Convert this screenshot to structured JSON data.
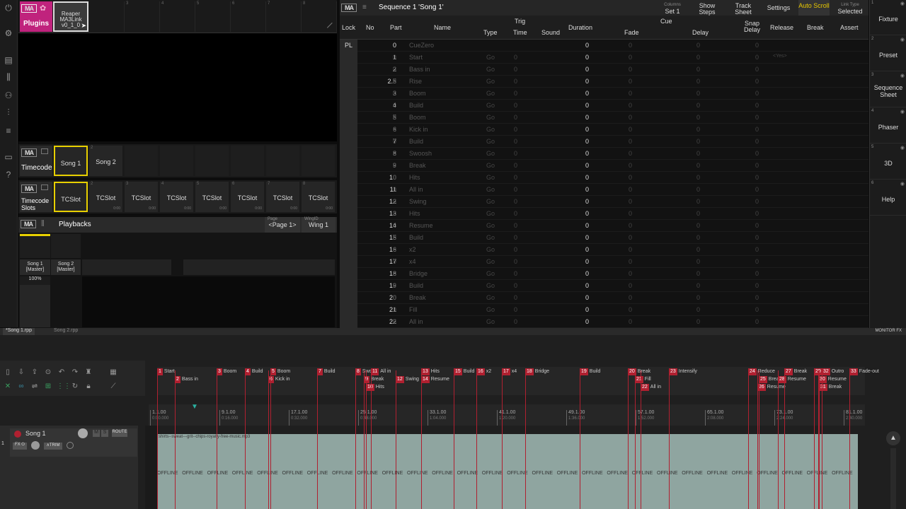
{
  "plugins_window": {
    "title": "Plugins",
    "plugin": {
      "name": "Reaper",
      "name2": "MA3Link",
      "version": "v0_1_0"
    }
  },
  "timecode_window": {
    "title": "Timecode",
    "slots": [
      "Song 1",
      "Song 2"
    ]
  },
  "timecode_slots_window": {
    "title": "Timecode Slots",
    "slots": [
      "TCSlot",
      "TCSlot",
      "TCSlot",
      "TCSlot",
      "TCSlot",
      "TCSlot",
      "TCSlot",
      "TCSlot"
    ],
    "times": [
      "0:00",
      "0:00",
      "0:00",
      "0:00",
      "0:00",
      "0:00",
      "0:00",
      "0:00"
    ]
  },
  "playbacks_window": {
    "title": "Playbacks",
    "page_label": "Page",
    "page_value": "<Page 1>",
    "wing_label": "WingID",
    "wing_value": "Wing 1",
    "executors": [
      "Song 1\n[Master]",
      "Song 2\n[Master]"
    ],
    "master_level": "100%"
  },
  "sequence_window": {
    "title": "Sequence 1 'Song 1'",
    "header_buttons": [
      {
        "small": "Columns",
        "label": "Set 1"
      },
      {
        "small": "",
        "label": "Show Steps"
      },
      {
        "small": "",
        "label": "Track Sheet"
      },
      {
        "small": "",
        "label": "Settings"
      },
      {
        "small": "",
        "label": "Auto Scroll"
      },
      {
        "small": "Link Type",
        "label": "Selected"
      }
    ],
    "columns": {
      "lock": "Lock",
      "no": "No",
      "part": "Part",
      "name": "Name",
      "trig": "Trig",
      "type": "Type",
      "time": "Time",
      "sound": "Sound",
      "duration": "Duration",
      "cue": "Cue",
      "fade": "Fade",
      "delay": "Delay",
      "snap": "Snap Delay",
      "release": "Release",
      "break": "Break",
      "assert": "Assert"
    },
    "rows": [
      {
        "lock": "PL",
        "no": "0",
        "part": "",
        "name": "CueZero",
        "type": "",
        "time": "",
        "dur": "0",
        "fade": "0",
        "delay": "0",
        "snap": "0",
        "rel": ""
      },
      {
        "lock": "",
        "no": "1",
        "part": "0",
        "name": "Start",
        "type": "Go",
        "time": "0",
        "dur": "0",
        "fade": "0",
        "delay": "0",
        "snap": "0",
        "rel": "<Yes>"
      },
      {
        "lock": "",
        "no": "2",
        "part": "0",
        "name": "Bass in",
        "type": "Go",
        "time": "0",
        "dur": "0",
        "fade": "0",
        "delay": "0",
        "snap": "0",
        "rel": ""
      },
      {
        "lock": "",
        "no": "2.5",
        "part": "0",
        "name": "Rise",
        "type": "Go",
        "time": "0",
        "dur": "0",
        "fade": "0",
        "delay": "0",
        "snap": "0",
        "rel": ""
      },
      {
        "lock": "",
        "no": "3",
        "part": "0",
        "name": "Boom",
        "type": "Go",
        "time": "0",
        "dur": "0",
        "fade": "0",
        "delay": "0",
        "snap": "0",
        "rel": ""
      },
      {
        "lock": "",
        "no": "4",
        "part": "0",
        "name": "Build",
        "type": "Go",
        "time": "0",
        "dur": "0",
        "fade": "0",
        "delay": "0",
        "snap": "0",
        "rel": ""
      },
      {
        "lock": "",
        "no": "5",
        "part": "0",
        "name": "Boom",
        "type": "Go",
        "time": "0",
        "dur": "0",
        "fade": "0",
        "delay": "0",
        "snap": "0",
        "rel": ""
      },
      {
        "lock": "",
        "no": "6",
        "part": "0",
        "name": "Kick in",
        "type": "Go",
        "time": "0",
        "dur": "0",
        "fade": "0",
        "delay": "0",
        "snap": "0",
        "rel": ""
      },
      {
        "lock": "",
        "no": "7",
        "part": "0",
        "name": "Build",
        "type": "Go",
        "time": "0",
        "dur": "0",
        "fade": "0",
        "delay": "0",
        "snap": "0",
        "rel": ""
      },
      {
        "lock": "",
        "no": "8",
        "part": "0",
        "name": "Swoosh",
        "type": "Go",
        "time": "0",
        "dur": "0",
        "fade": "0",
        "delay": "0",
        "snap": "0",
        "rel": ""
      },
      {
        "lock": "",
        "no": "9",
        "part": "0",
        "name": "Break",
        "type": "Go",
        "time": "0",
        "dur": "0",
        "fade": "0",
        "delay": "0",
        "snap": "0",
        "rel": ""
      },
      {
        "lock": "",
        "no": "10",
        "part": "0",
        "name": "Hits",
        "type": "Go",
        "time": "0",
        "dur": "0",
        "fade": "0",
        "delay": "0",
        "snap": "0",
        "rel": ""
      },
      {
        "lock": "",
        "no": "11",
        "part": "0",
        "name": "All in",
        "type": "Go",
        "time": "0",
        "dur": "0",
        "fade": "0",
        "delay": "0",
        "snap": "0",
        "rel": ""
      },
      {
        "lock": "",
        "no": "12",
        "part": "0",
        "name": "Swing",
        "type": "Go",
        "time": "0",
        "dur": "0",
        "fade": "0",
        "delay": "0",
        "snap": "0",
        "rel": ""
      },
      {
        "lock": "",
        "no": "13",
        "part": "0",
        "name": "Hits",
        "type": "Go",
        "time": "0",
        "dur": "0",
        "fade": "0",
        "delay": "0",
        "snap": "0",
        "rel": ""
      },
      {
        "lock": "",
        "no": "14",
        "part": "0",
        "name": "Resume",
        "type": "Go",
        "time": "0",
        "dur": "0",
        "fade": "0",
        "delay": "0",
        "snap": "0",
        "rel": ""
      },
      {
        "lock": "",
        "no": "15",
        "part": "0",
        "name": "Build",
        "type": "Go",
        "time": "0",
        "dur": "0",
        "fade": "0",
        "delay": "0",
        "snap": "0",
        "rel": ""
      },
      {
        "lock": "",
        "no": "16",
        "part": "0",
        "name": "x2",
        "type": "Go",
        "time": "0",
        "dur": "0",
        "fade": "0",
        "delay": "0",
        "snap": "0",
        "rel": ""
      },
      {
        "lock": "",
        "no": "17",
        "part": "0",
        "name": "x4",
        "type": "Go",
        "time": "0",
        "dur": "0",
        "fade": "0",
        "delay": "0",
        "snap": "0",
        "rel": ""
      },
      {
        "lock": "",
        "no": "18",
        "part": "0",
        "name": "Bridge",
        "type": "Go",
        "time": "0",
        "dur": "0",
        "fade": "0",
        "delay": "0",
        "snap": "0",
        "rel": ""
      },
      {
        "lock": "",
        "no": "19",
        "part": "0",
        "name": "Build",
        "type": "Go",
        "time": "0",
        "dur": "0",
        "fade": "0",
        "delay": "0",
        "snap": "0",
        "rel": ""
      },
      {
        "lock": "",
        "no": "20",
        "part": "0",
        "name": "Break",
        "type": "Go",
        "time": "0",
        "dur": "0",
        "fade": "0",
        "delay": "0",
        "snap": "0",
        "rel": ""
      },
      {
        "lock": "",
        "no": "21",
        "part": "0",
        "name": "Fill",
        "type": "Go",
        "time": "0",
        "dur": "0",
        "fade": "0",
        "delay": "0",
        "snap": "0",
        "rel": ""
      },
      {
        "lock": "",
        "no": "22",
        "part": "0",
        "name": "All in",
        "type": "Go",
        "time": "0",
        "dur": "0",
        "fade": "0",
        "delay": "0",
        "snap": "0",
        "rel": ""
      }
    ]
  },
  "right_bar": [
    {
      "n": "1",
      "label": "Fixture"
    },
    {
      "n": "2",
      "label": "Preset"
    },
    {
      "n": "3",
      "label": "Sequence Sheet"
    },
    {
      "n": "4",
      "label": "Phaser"
    },
    {
      "n": "5",
      "label": "3D"
    },
    {
      "n": "6",
      "label": "Help"
    }
  ],
  "reaper": {
    "tabs": [
      "*Song 1.rpp",
      "Song 2.rpp"
    ],
    "monitor_fx": "MONITOR FX",
    "track_name": "Song 1",
    "route_label": "ROUTE",
    "item_name": "shirts--sweat---grit--chips-royalty-free-music.mp3",
    "offline_label": "OFFLINE",
    "markers_row1": [
      {
        "n": "1",
        "label": "Start"
      },
      {
        "n": "3",
        "label": "Boom"
      },
      {
        "n": "4",
        "label": "Build"
      },
      {
        "n": "5",
        "label": "Boom"
      },
      {
        "n": "7",
        "label": "Build"
      },
      {
        "n": "8",
        "label": "Swo"
      },
      {
        "n": "11",
        "label": "All in"
      },
      {
        "n": "13",
        "label": "Hits"
      },
      {
        "n": "15",
        "label": "Build"
      },
      {
        "n": "16",
        "label": "x2"
      },
      {
        "n": "17",
        "label": "x4"
      },
      {
        "n": "18",
        "label": "Bridge"
      },
      {
        "n": "19",
        "label": "Build"
      },
      {
        "n": "20",
        "label": "Break"
      },
      {
        "n": "23",
        "label": "Intensify"
      },
      {
        "n": "24",
        "label": "Reduce"
      },
      {
        "n": "27",
        "label": "Break"
      },
      {
        "n": "29",
        "label": ""
      },
      {
        "n": "32",
        "label": "Outro"
      },
      {
        "n": "33",
        "label": "Fade-out"
      }
    ],
    "markers_row2": [
      {
        "n": "2",
        "label": "Bass in"
      },
      {
        "n": "6",
        "label": "Kick in"
      },
      {
        "n": "9",
        "label": "Break"
      },
      {
        "n": "12",
        "label": "Swing"
      },
      {
        "n": "14",
        "label": "Resume"
      },
      {
        "n": "21",
        "label": "Fill"
      },
      {
        "n": "25",
        "label": "Break"
      },
      {
        "n": "28",
        "label": "Resume"
      },
      {
        "n": "30",
        "label": "Resume"
      }
    ],
    "markers_row3": [
      {
        "n": "10",
        "label": "Hits"
      },
      {
        "n": "22",
        "label": "All in"
      },
      {
        "n": "26",
        "label": "Resume"
      },
      {
        "n": "31",
        "label": "Break"
      }
    ],
    "ruler": [
      {
        "bar": "1.1.00",
        "time": "0:00.000"
      },
      {
        "bar": "9.1.00",
        "time": "0:16.000"
      },
      {
        "bar": "17.1.00",
        "time": "0:32.000"
      },
      {
        "bar": "25.1.00",
        "time": "0:48.000"
      },
      {
        "bar": "33.1.00",
        "time": "1:04.000"
      },
      {
        "bar": "41.1.00",
        "time": "1:20.000"
      },
      {
        "bar": "49.1.00",
        "time": "1:36.000"
      },
      {
        "bar": "57.1.00",
        "time": "1:52.000"
      },
      {
        "bar": "65.1.00",
        "time": "2:08.000"
      },
      {
        "bar": "73.1.00",
        "time": "2:24.000"
      },
      {
        "bar": "81.1.00",
        "time": "2:40.000"
      }
    ],
    "track_number": "1"
  },
  "colors": {
    "accent_yellow": "#e8d000",
    "marker_red": "#b02030",
    "plugins_magenta": "#c0237d",
    "auto_scroll": "#e8c800"
  }
}
